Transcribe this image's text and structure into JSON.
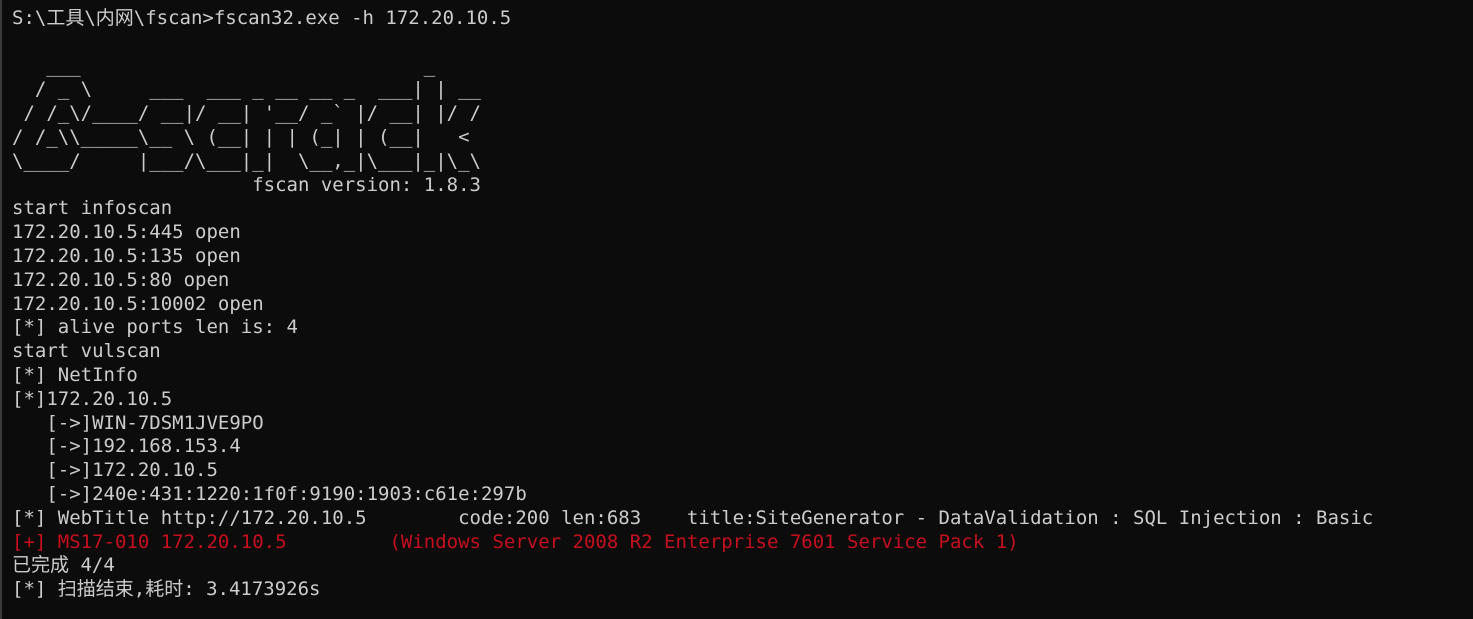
{
  "terminal": {
    "command_line": "S:\\工具\\内网\\fscan>fscan32.exe -h 172.20.10.5",
    "banner": [
      "   ___                              _",
      "  / _ \\     ___  ___ _ __ __ _  ___| | __",
      " / /_\\/____/ __|/ __| '__/ _` |/ __| |/ /",
      "/ /_\\\\_____\\__ \\ (__| | | (_| | (__|   <",
      "\\____/     |___/\\___|_|  \\__,_|\\___|_|\\_\\",
      "                     fscan version: 1.8.3"
    ],
    "output": [
      {
        "text": "start infoscan",
        "color": "normal"
      },
      {
        "text": "172.20.10.5:445 open",
        "color": "normal"
      },
      {
        "text": "172.20.10.5:135 open",
        "color": "normal"
      },
      {
        "text": "172.20.10.5:80 open",
        "color": "normal"
      },
      {
        "text": "172.20.10.5:10002 open",
        "color": "normal"
      },
      {
        "text": "[*] alive ports len is: 4",
        "color": "normal"
      },
      {
        "text": "start vulscan",
        "color": "normal"
      },
      {
        "text": "[*] NetInfo",
        "color": "normal"
      },
      {
        "text": "[*]172.20.10.5",
        "color": "normal"
      },
      {
        "text": "   [->]WIN-7DSM1JVE9PO",
        "color": "normal"
      },
      {
        "text": "   [->]192.168.153.4",
        "color": "normal"
      },
      {
        "text": "   [->]172.20.10.5",
        "color": "normal"
      },
      {
        "text": "   [->]240e:431:1220:1f0f:9190:1903:c61e:297b",
        "color": "normal"
      },
      {
        "text": "[*] WebTitle http://172.20.10.5        code:200 len:683    title:SiteGenerator - DataValidation : SQL Injection : Basic",
        "color": "normal"
      },
      {
        "text": "[+] MS17-010 172.20.10.5         (Windows Server 2008 R2 Enterprise 7601 Service Pack 1)",
        "color": "red"
      },
      {
        "text": "已完成 4/4",
        "color": "normal"
      },
      {
        "text": "[*] 扫描结束,耗时: 3.4173926s",
        "color": "normal"
      }
    ]
  },
  "colors": {
    "background": "#0c0c0c",
    "text": "#cccccc",
    "red": "#c50f1f"
  }
}
